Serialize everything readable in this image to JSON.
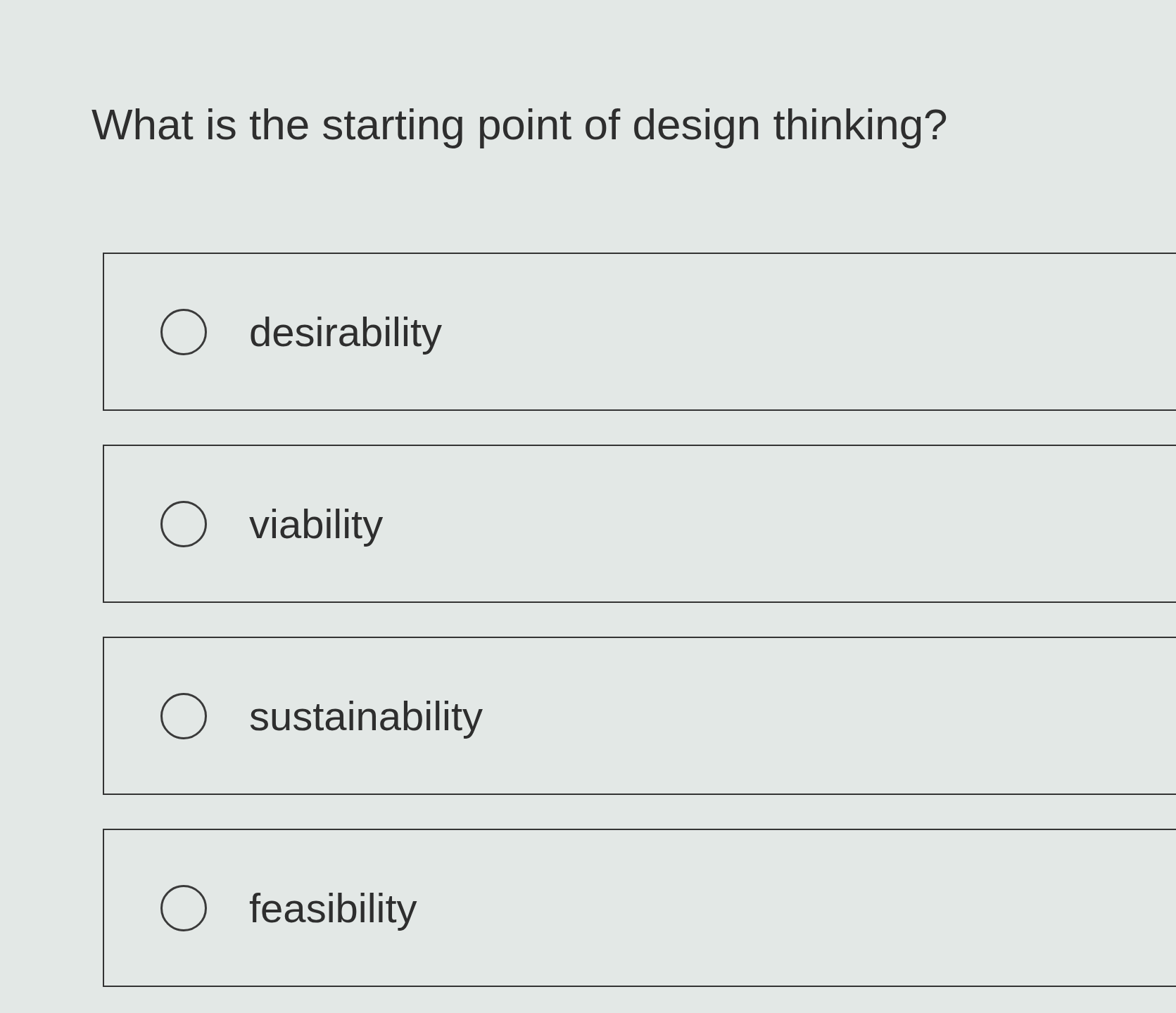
{
  "question": "What is the starting point of design thinking?",
  "options": [
    {
      "label": "desirability",
      "selected": false
    },
    {
      "label": "viability",
      "selected": false
    },
    {
      "label": "sustainability",
      "selected": false
    },
    {
      "label": "feasibility",
      "selected": false
    }
  ]
}
